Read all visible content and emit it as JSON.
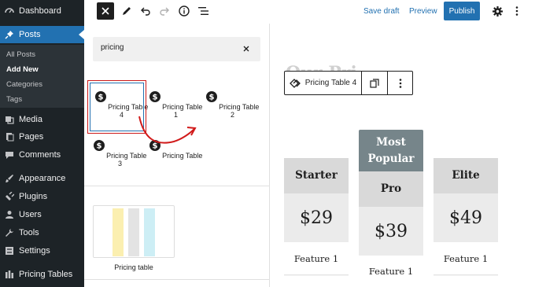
{
  "sidebar": {
    "items": [
      {
        "label": "Dashboard",
        "icon": "dashboard-icon"
      },
      {
        "label": "Posts",
        "icon": "pin-icon"
      },
      {
        "label": "Media",
        "icon": "media-icon"
      },
      {
        "label": "Pages",
        "icon": "pages-icon"
      },
      {
        "label": "Comments",
        "icon": "comments-icon"
      },
      {
        "label": "Appearance",
        "icon": "paintbrush-icon"
      },
      {
        "label": "Plugins",
        "icon": "plugins-icon"
      },
      {
        "label": "Users",
        "icon": "users-icon"
      },
      {
        "label": "Tools",
        "icon": "wrench-icon"
      },
      {
        "label": "Settings",
        "icon": "settings-icon"
      },
      {
        "label": "Pricing Tables",
        "icon": "table-icon"
      }
    ],
    "submenu": [
      "All Posts",
      "Add New",
      "Categories",
      "Tags"
    ],
    "accent": "#2271b1"
  },
  "topbar": {
    "save_draft": "Save draft",
    "preview": "Preview",
    "publish": "Publish"
  },
  "inserter": {
    "search_value": "pricing",
    "blocks": [
      "Pricing Table 4",
      "Pricing Table 1",
      "Pricing Table 2",
      "Pricing Table 3",
      "Pricing Table"
    ],
    "pattern_label": "Pricing table"
  },
  "canvas": {
    "ghost_title": "Our Pri",
    "toolbar_block_name": "Pricing Table 4",
    "tables": [
      {
        "head": "Starter",
        "price": "$29",
        "feature": "Feature 1"
      },
      {
        "ribbon": "Most Popular",
        "head": "Pro",
        "price": "$39",
        "feature": "Feature 1"
      },
      {
        "head": "Elite",
        "price": "$49",
        "feature": "Feature 1"
      }
    ],
    "ribbon_color": "#76858a"
  }
}
